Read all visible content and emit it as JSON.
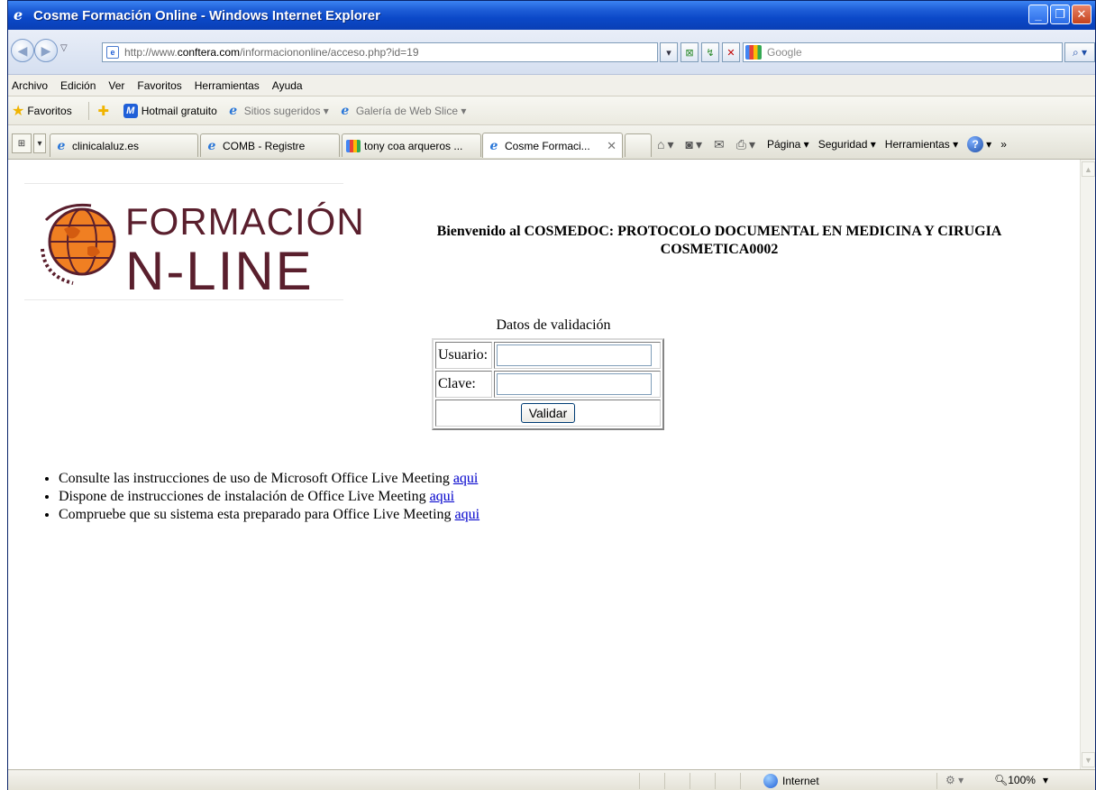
{
  "window": {
    "title": "Cosme Formación Online - Windows Internet Explorer",
    "controls": [
      "_",
      "❐",
      "✕"
    ]
  },
  "address": {
    "url_prefix": "http://www.",
    "url_domain": "conftera.com",
    "url_path": "/informaciononline/acceso.php?id=19",
    "search_placeholder": "Google"
  },
  "menu": [
    "Archivo",
    "Edición",
    "Ver",
    "Favoritos",
    "Herramientas",
    "Ayuda"
  ],
  "favorites": {
    "label": "Favoritos",
    "items": [
      "Hotmail gratuito",
      "Sitios sugeridos ▾",
      "Galería de Web Slice ▾"
    ]
  },
  "tabs": [
    {
      "label": "clinicalaluz.es"
    },
    {
      "label": "COMB - Registre"
    },
    {
      "label": "tony coa arqueros ..."
    },
    {
      "label": "Cosme Formaci..."
    }
  ],
  "commands": {
    "page": "Página ▾",
    "security": "Seguridad ▾",
    "tools": "Herramientas ▾",
    "more": "»"
  },
  "page": {
    "logo_line1": "FORMACIÓN",
    "logo_line2": "N-LINE",
    "welcome_line1": "Bienvenido al COSMEDOC: PROTOCOLO DOCUMENTAL EN MEDICINA Y CIRUGIA",
    "welcome_line2": "COSMETICA0002",
    "validation_caption": "Datos de validación",
    "user_label": "Usuario:",
    "password_label": "Clave:",
    "user_value": "",
    "password_value": "",
    "submit_label": "Validar",
    "info_items": [
      {
        "text": "Consulte las instrucciones de uso de Microsoft Office Live Meeting ",
        "link": "aqui"
      },
      {
        "text": "Dispone de instrucciones de instalación de Office Live Meeting ",
        "link": "aqui"
      },
      {
        "text": "Compruebe que su sistema esta preparado para Office Live Meeting ",
        "link": "aqui"
      }
    ]
  },
  "status": {
    "zone": "Internet",
    "zoom": "100%"
  }
}
